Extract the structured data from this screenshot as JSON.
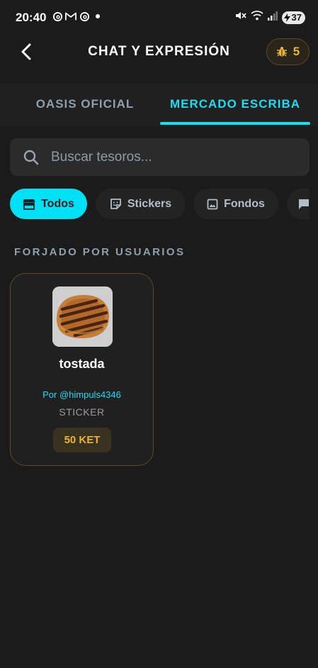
{
  "status_bar": {
    "time": "20:40",
    "battery": "37",
    "apps": [
      "threads-icon",
      "gmail-icon",
      "threads-icon",
      "dot"
    ]
  },
  "header": {
    "title": "CHAT Y EXPRESIÓN",
    "coins": "5"
  },
  "tabs": [
    {
      "label": "OASIS OFICIAL",
      "active": false
    },
    {
      "label": "MERCADO ESCRIBA",
      "active": true
    }
  ],
  "search": {
    "placeholder": "Buscar tesoros..."
  },
  "filters": [
    {
      "label": "Todos",
      "icon": "store-icon",
      "active": true
    },
    {
      "label": "Stickers",
      "icon": "sticker-icon",
      "active": false
    },
    {
      "label": "Fondos",
      "icon": "image-icon",
      "active": false
    },
    {
      "label": "",
      "icon": "bubble-icon",
      "active": false
    }
  ],
  "section": {
    "heading": "FORJADO POR USUARIOS"
  },
  "items": [
    {
      "name": "tostada",
      "author": "Por @himpuls4346",
      "type": "STICKER",
      "price": "50 KET"
    }
  ],
  "colors": {
    "accent": "#1fdcf2",
    "gold": "#e8b33a",
    "background": "#1b1b1b"
  }
}
